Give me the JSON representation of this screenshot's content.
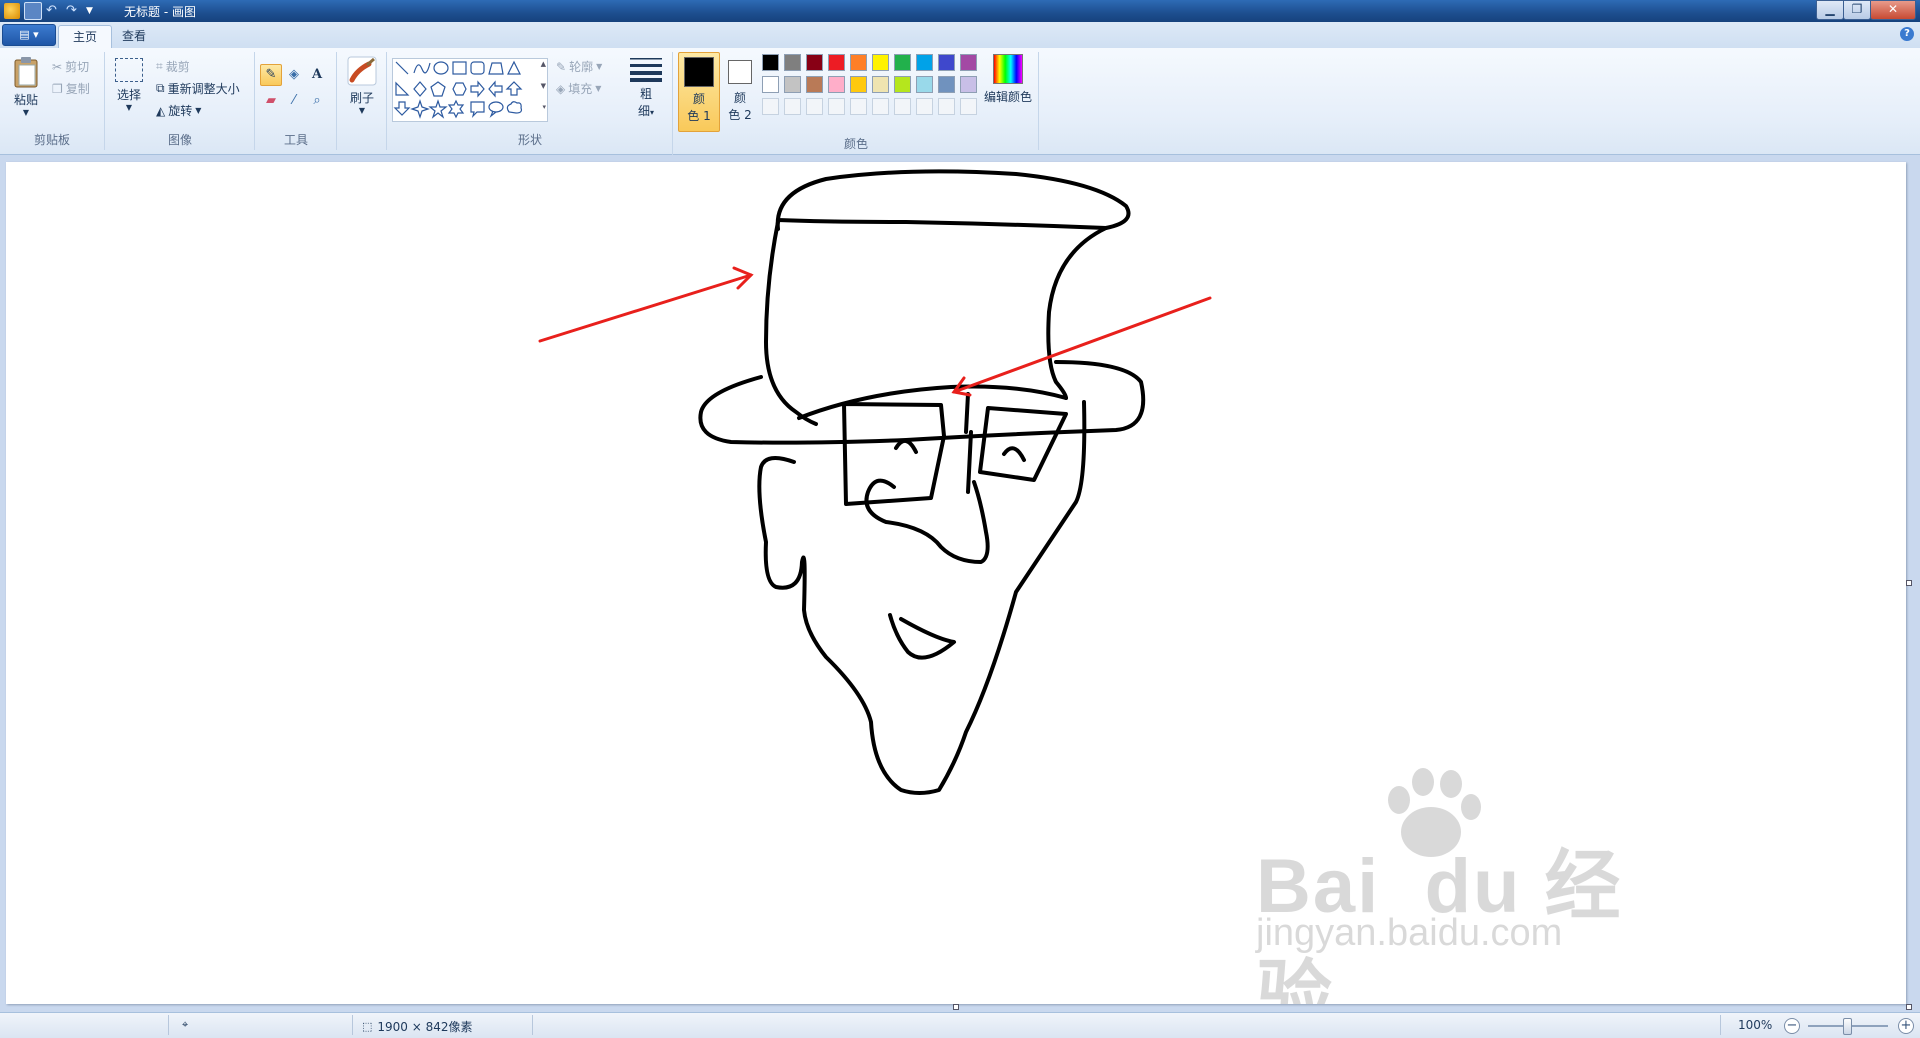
{
  "window": {
    "title": "无标题 - 画图",
    "minimize": "▁",
    "restore": "❐",
    "close": "✕"
  },
  "tabs": [
    {
      "label": "主页",
      "active": true
    },
    {
      "label": "查看",
      "active": false
    }
  ],
  "help_icon": "?",
  "ribbon": {
    "clipboard": {
      "group_label": "剪贴板",
      "paste": "粘贴",
      "cut": "剪切",
      "copy": "复制"
    },
    "image": {
      "group_label": "图像",
      "select": "选择",
      "crop": "裁剪",
      "resize": "重新调整大小",
      "rotate": "旋转"
    },
    "tools": {
      "group_label": "工具",
      "text_tool": "A"
    },
    "brushes": {
      "label": "刷子"
    },
    "shapes": {
      "group_label": "形状",
      "outline": "轮廓",
      "fill": "填充"
    },
    "size": {
      "label_line1": "粗",
      "label_line2": "细"
    },
    "colors": {
      "group_label": "颜色",
      "color1_line1": "颜",
      "color1_line2": "色 1",
      "color2_line1": "颜",
      "color2_line2": "色 2",
      "edit_colors": "编辑颜色",
      "color1_value": "#000000",
      "color2_value": "#ffffff",
      "palette_row1": [
        "#000000",
        "#7f7f7f",
        "#880015",
        "#ed1c24",
        "#ff7f27",
        "#fff200",
        "#22b14c",
        "#00a2e8",
        "#3f48cc",
        "#a349a4"
      ],
      "palette_row2": [
        "#ffffff",
        "#c3c3c3",
        "#b97a57",
        "#ffaec9",
        "#ffc90e",
        "#efe4b0",
        "#b5e61d",
        "#99d9ea",
        "#7092be",
        "#c8bfe7"
      ]
    }
  },
  "drawing": {
    "stroke_color": "#000000",
    "arrow_color": "#e8201c"
  },
  "status": {
    "dimensions": "1900 × 842像素",
    "zoom": "100%",
    "zoom_out": "−",
    "zoom_in": "+"
  }
}
